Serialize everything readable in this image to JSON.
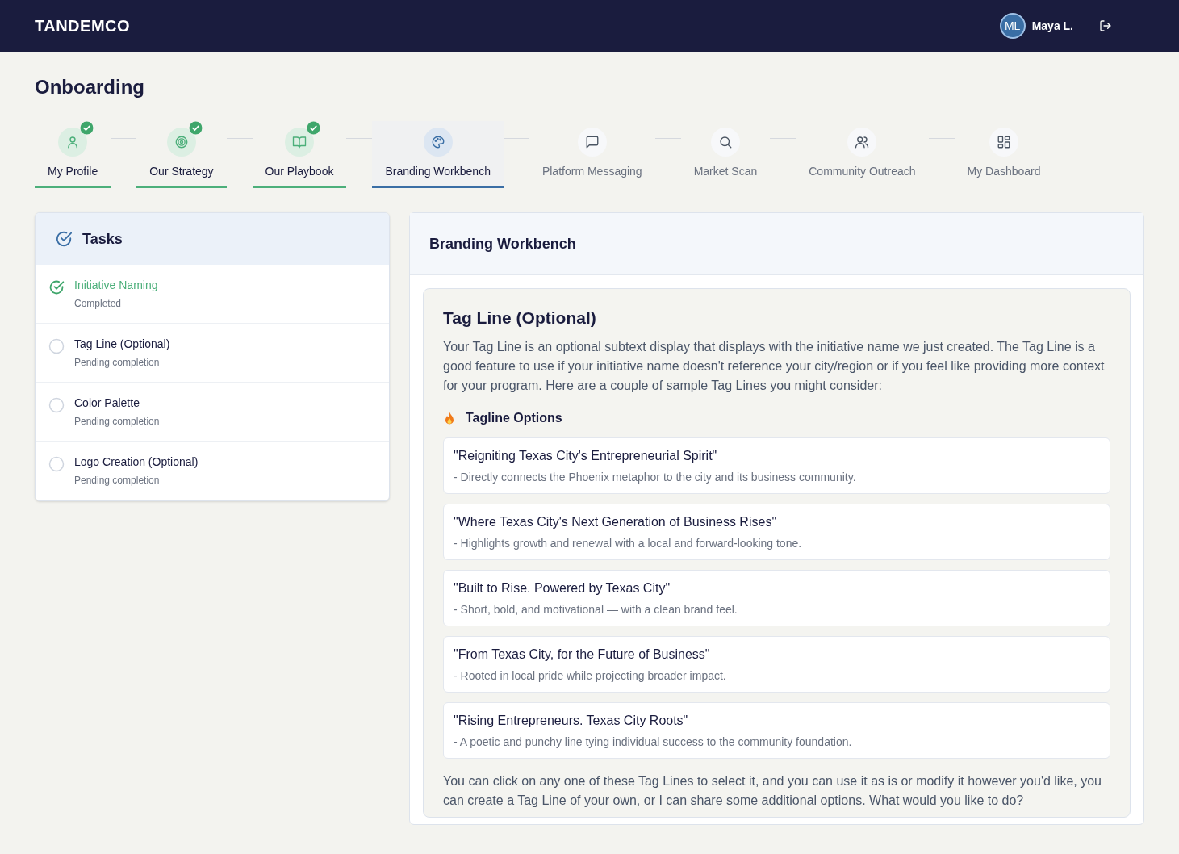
{
  "header": {
    "logo": "TANDEMCO",
    "user": {
      "initials": "ML",
      "name": "Maya L."
    }
  },
  "page_title": "Onboarding",
  "steps": [
    {
      "label": "My Profile",
      "completed": true,
      "selected": false
    },
    {
      "label": "Our Strategy",
      "completed": true,
      "selected": false
    },
    {
      "label": "Our Playbook",
      "completed": true,
      "selected": false
    },
    {
      "label": "Branding Workbench",
      "completed": false,
      "selected": true
    },
    {
      "label": "Platform Messaging",
      "completed": false,
      "selected": false
    },
    {
      "label": "Market Scan",
      "completed": false,
      "selected": false
    },
    {
      "label": "Community Outreach",
      "completed": false,
      "selected": false
    },
    {
      "label": "My Dashboard",
      "completed": false,
      "selected": false
    }
  ],
  "tasks": {
    "title": "Tasks",
    "items": [
      {
        "title": "Initiative Naming",
        "status": "Completed",
        "completed": true
      },
      {
        "title": "Tag Line (Optional)",
        "status": "Pending completion",
        "completed": false
      },
      {
        "title": "Color Palette",
        "status": "Pending completion",
        "completed": false
      },
      {
        "title": "Logo Creation (Optional)",
        "status": "Pending completion",
        "completed": false
      }
    ]
  },
  "workbench": {
    "title": "Branding Workbench",
    "section_title": "Tag Line (Optional)",
    "intro": "Your Tag Line is an optional subtext display that displays with the initiative name we just created. The Tag Line is a good feature to use if your initiative name doesn't reference your city/region or if you feel like providing more context for your program. Here are a couple of sample Tag Lines you might consider:",
    "options_title": "Tagline Options",
    "options": [
      {
        "title": "\"Reigniting Texas City's Entrepreneurial Spirit\"",
        "note": "- Directly connects the Phoenix metaphor to the city and its business community."
      },
      {
        "title": "\"Where Texas City's Next Generation of Business Rises\"",
        "note": "- Highlights growth and renewal with a local and forward-looking tone."
      },
      {
        "title": "\"Built to Rise. Powered by Texas City\"",
        "note": "- Short, bold, and motivational — with a clean brand feel."
      },
      {
        "title": "\"From Texas City, for the Future of Business\"",
        "note": "- Rooted in local pride while projecting broader impact."
      },
      {
        "title": "\"Rising Entrepreneurs. Texas City Roots\"",
        "note": "- A poetic and punchy line tying individual success to the community foundation."
      }
    ],
    "outro": "You can click on any one of these Tag Lines to select it, and you can use it as is or modify it however you'd like, you can create a Tag Line of your own, or I can share some additional options. What would you like to do?"
  }
}
